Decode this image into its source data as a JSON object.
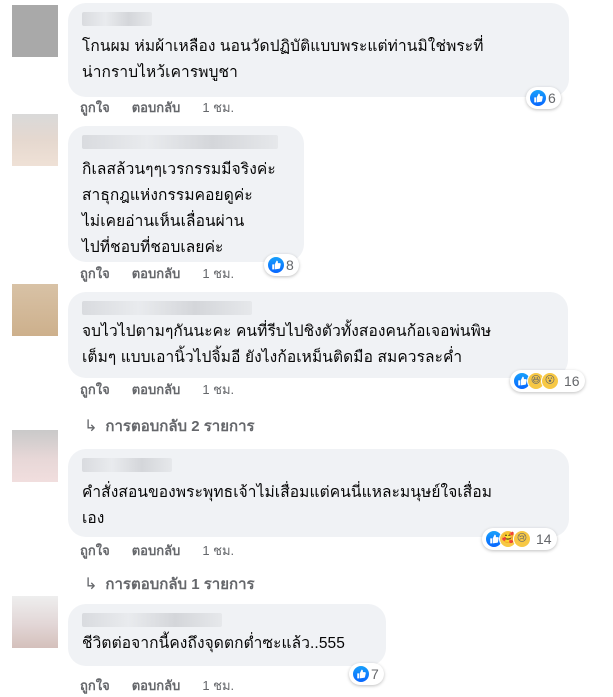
{
  "comments": [
    {
      "text": "โกนผม ห่มผ้าเหลือง นอนวัดปฏิบัติแบบพระแต่ท่านมิใช่พระที่\nน่ากราบไหว้เคารพบูชา",
      "reaction_count": "6",
      "reactions": [
        "like-icon"
      ],
      "like": "ถูกใจ",
      "reply": "ตอบกลับ",
      "time": "1 ชม."
    },
    {
      "text": "กิเลสล้วนๆๆเวรกรรมมีจริงค่ะ\nสาธุกฎแห่งกรรมคอยดูค่ะ\nไม่เคยอ่านเห็นเลื่อนผ่าน\nไปที่ชอบที่ชอบเลยค่ะ",
      "reaction_count": "8",
      "reactions": [
        "like-icon"
      ],
      "like": "ถูกใจ",
      "reply": "ตอบกลับ",
      "time": "1 ชม."
    },
    {
      "text": "จบไวไปตามๆกันนะคะ คนที่รีบไปชิงตัวทั้งสองคนก้อเจอพ่นพิษ\nเต็มๆ แบบเอานิ้วไปจิ้มอี ยังไงก้อเหม็นติดมือ สมควรละค่ำ",
      "reaction_count": "16",
      "reactions": [
        "like-icon",
        "haha-icon",
        "wow-icon"
      ],
      "like": "ถูกใจ",
      "reply": "ตอบกลับ",
      "time": "1 ชม.",
      "replies_label": "การตอบกลับ 2 รายการ"
    },
    {
      "text": "คำสั่งสอนของพระพุทธเจ้าไม่เสื่อมแต่คนนี่แหละมนุษย์ใจเสื่อม\nเอง",
      "reaction_count": "14",
      "reactions": [
        "like-icon",
        "care-icon",
        "sad-icon"
      ],
      "like": "ถูกใจ",
      "reply": "ตอบกลับ",
      "time": "1 ชม.",
      "replies_label": "การตอบกลับ 1 รายการ"
    },
    {
      "text": "ชีวิตต่อจากนี้คงถึงจุดตกต่ำซะแล้ว..555",
      "reaction_count": "7",
      "reactions": [
        "like-icon"
      ],
      "like": "ถูกใจ",
      "reply": "ตอบกลับ",
      "time": "1 ชม."
    }
  ],
  "colors": {
    "bubble": "#f0f2f5",
    "secondary_text": "#65676b",
    "like_blue": "#0866ff"
  }
}
